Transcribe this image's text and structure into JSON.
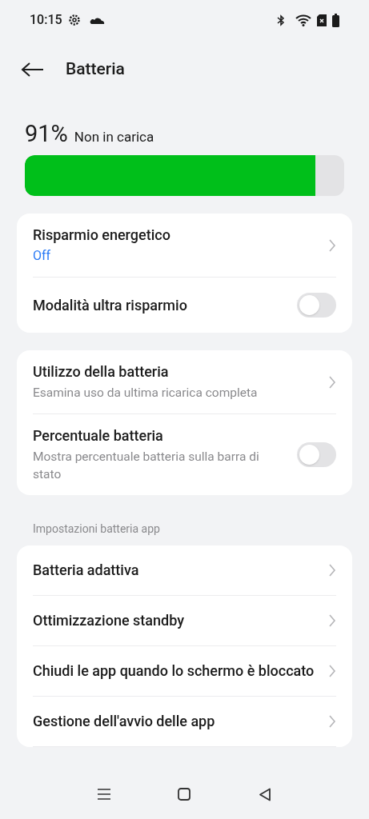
{
  "status_bar": {
    "time": "10:15"
  },
  "header": {
    "title": "Batteria"
  },
  "battery": {
    "percent": "91%",
    "status": "Non in carica",
    "level": 0.91
  },
  "cards": [
    {
      "items": [
        {
          "kind": "link",
          "title": "Risparmio energetico",
          "value": "Off"
        },
        {
          "kind": "toggle",
          "title": "Modalità ultra risparmio",
          "on": false
        }
      ]
    },
    {
      "items": [
        {
          "kind": "link",
          "title": "Utilizzo della batteria",
          "subtitle": "Esamina uso da ultima ricarica completa"
        },
        {
          "kind": "toggle",
          "title": "Percentuale batteria",
          "subtitle": "Mostra percentuale batteria sulla barra di stato",
          "on": false
        }
      ]
    },
    {
      "heading": "Impostazioni batteria app",
      "items": [
        {
          "kind": "link",
          "title": "Batteria adattiva"
        },
        {
          "kind": "link",
          "title": "Ottimizzazione standby"
        },
        {
          "kind": "link",
          "title": "Chiudi le app quando lo schermo è bloccato"
        },
        {
          "kind": "link",
          "title": "Gestione dell'avvio delle app"
        }
      ]
    }
  ]
}
